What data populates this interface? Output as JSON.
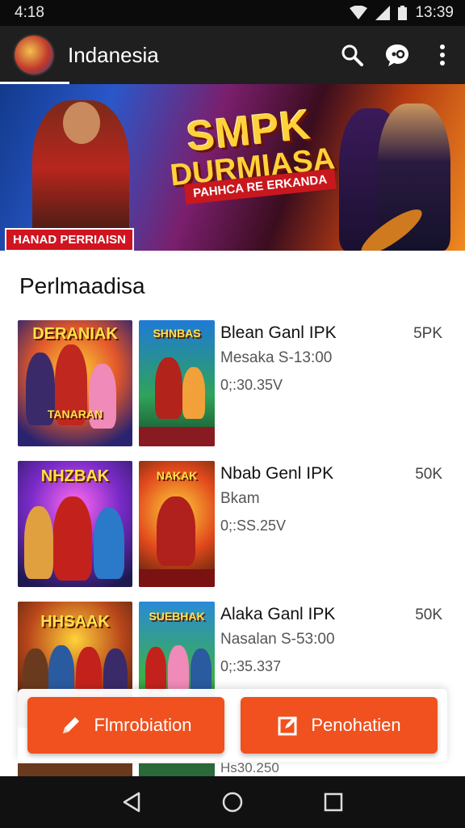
{
  "status_bar": {
    "time": "4:18",
    "right_time": "13:39"
  },
  "app_bar": {
    "title": "Indanesia"
  },
  "banner": {
    "title_line1": "SMPK",
    "title_line2": "DURMIASA",
    "subtitle": "PAHHCA RE ERKANDA",
    "label": "HANAD PERRIAISN"
  },
  "section": {
    "title": "Perlmaadisa"
  },
  "items": [
    {
      "title": "Blean Ganl IPK",
      "meta": "Mesaka S-13:00",
      "size": "0;:30.35V",
      "badge": "5PK",
      "thumb1_caption": "DERANIAK",
      "thumb1_caption2": "TANARAN",
      "thumb2_caption": "SHNBAS"
    },
    {
      "title": "Nbab Genl IPK",
      "meta": "Bkam",
      "size": "0;:SS.25V",
      "badge": "50K",
      "thumb1_caption": "NHZBAK",
      "thumb1_caption2": "",
      "thumb2_caption": "NAKAK"
    },
    {
      "title": "Alaka Ganl IPK",
      "meta": "Nasalan S-53:00",
      "size": "0;:35.337",
      "badge": "50K",
      "thumb1_caption": "HHSAAK",
      "thumb1_caption2": "",
      "thumb2_caption": "SUEBHAK"
    }
  ],
  "peek_text": "Hs30.250",
  "buttons": {
    "primary": "Flmrobiation",
    "secondary": "Penohatien"
  },
  "icons": {
    "search": "search-icon",
    "chat": "chat-bubble-icon",
    "more": "more-vert-icon",
    "back": "back-triangle-icon",
    "home": "home-circle-icon",
    "recents": "recents-square-icon",
    "pencil": "pencil-icon",
    "edit_box": "edit-square-icon"
  },
  "colors": {
    "accent": "#f0511e",
    "appbar": "#1f1f1f",
    "statusbar": "#0b0b0b"
  }
}
